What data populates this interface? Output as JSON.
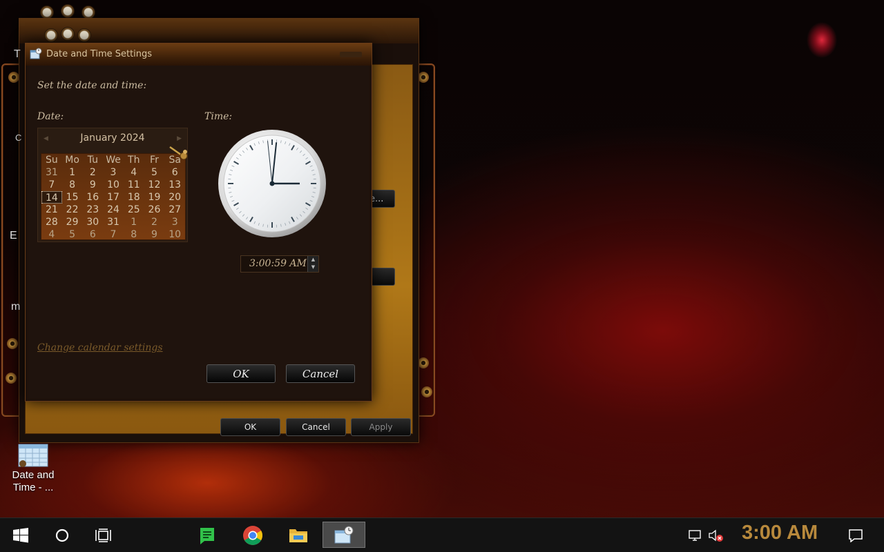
{
  "back_window": {
    "buttons": {
      "ok": "OK",
      "cancel": "Cancel",
      "apply": "Apply"
    },
    "side_button_text": "e...",
    "edge_letters": [
      "T",
      "C",
      "E",
      "m"
    ]
  },
  "dialog": {
    "title": "Date and Time Settings",
    "instruction": "Set the date and time:",
    "date_label": "Date:",
    "time_label": "Time:",
    "calendar": {
      "month_year": "January 2024",
      "weekdays": [
        "Su",
        "Mo",
        "Tu",
        "We",
        "Th",
        "Fr",
        "Sa"
      ],
      "weeks": [
        [
          "31",
          "1",
          "2",
          "3",
          "4",
          "5",
          "6"
        ],
        [
          "7",
          "8",
          "9",
          "10",
          "11",
          "12",
          "13"
        ],
        [
          "14",
          "15",
          "16",
          "17",
          "18",
          "19",
          "20"
        ],
        [
          "21",
          "22",
          "23",
          "24",
          "25",
          "26",
          "27"
        ],
        [
          "28",
          "29",
          "30",
          "31",
          "1",
          "2",
          "3"
        ],
        [
          "4",
          "5",
          "6",
          "7",
          "8",
          "9",
          "10"
        ]
      ],
      "selected_day": "14"
    },
    "time_value": "3:00:59 AM",
    "clock": {
      "hour": 3,
      "minute": 0,
      "second": 59
    },
    "change_calendar_link": "Change calendar settings",
    "ok_label": "OK",
    "cancel_label": "Cancel"
  },
  "desktop_icon": {
    "label_line1": "Date and",
    "label_line2": "Time - ..."
  },
  "taskbar": {
    "time": "3:00 AM",
    "apps": [
      "start-icon",
      "cortana-icon",
      "task-view-icon",
      "green-app-icon",
      "chrome-icon",
      "file-explorer-icon",
      "date-time-app-icon"
    ],
    "tray": [
      "network-icon",
      "volume-muted-icon",
      "notification-icon"
    ]
  }
}
